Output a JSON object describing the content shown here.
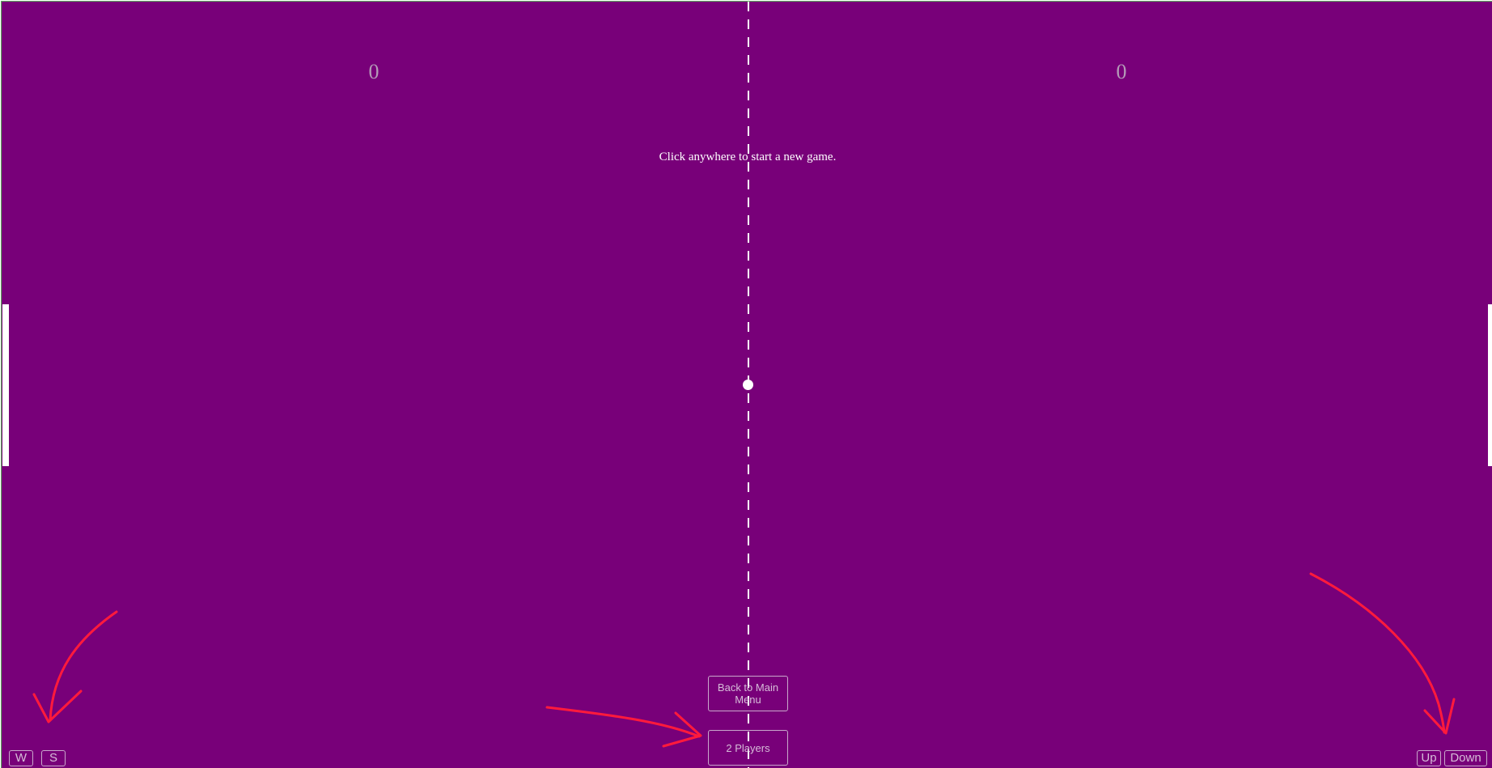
{
  "scoreboard": {
    "left_score": "0",
    "right_score": "0"
  },
  "message": "Click anywhere to start a new game.",
  "buttons": {
    "back_to_main_menu": "Back to Main Menu",
    "players_mode": "2 Players"
  },
  "controls": {
    "left_player": {
      "up_key": "W",
      "down_key": "S"
    },
    "right_player": {
      "up_key": "Up",
      "down_key": "Down"
    }
  },
  "colors": {
    "court_background": "#780079",
    "paddles_ball_line": "#ffffff",
    "score_text": "#b49bb8",
    "annotation_arrows": "#ff1a3c"
  }
}
